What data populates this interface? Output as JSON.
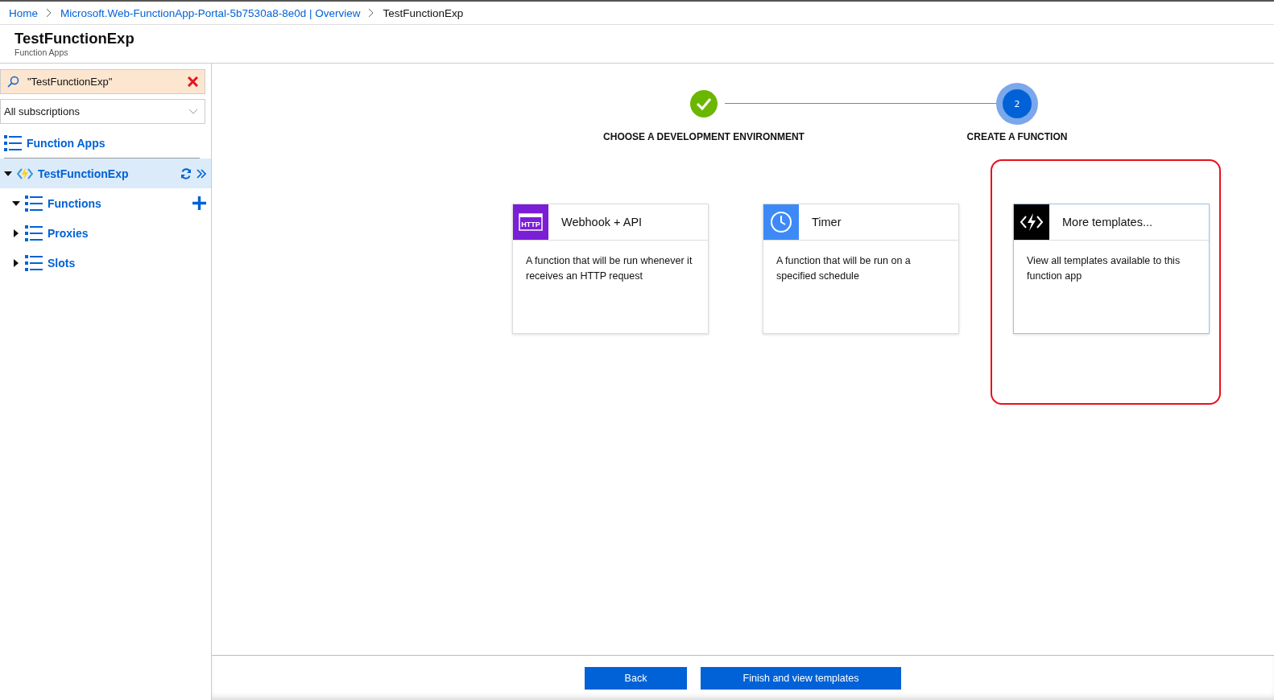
{
  "breadcrumb": [
    {
      "label": "Home",
      "link": true
    },
    {
      "label": "Microsoft.Web-FunctionApp-Portal-5b7530a8-8e0d | Overview",
      "link": true
    },
    {
      "label": "TestFunctionExp",
      "link": false
    }
  ],
  "header": {
    "title": "TestFunctionExp",
    "subtitle": "Function Apps"
  },
  "sidebar": {
    "search": {
      "value": "\"TestFunctionExp\""
    },
    "subscription": {
      "value": "All subscriptions"
    },
    "root": {
      "label": "Function Apps"
    },
    "tree": [
      {
        "label": "TestFunctionExp",
        "kind": "app",
        "expanded": true,
        "selected": true,
        "children": [
          {
            "label": "Functions",
            "kind": "list",
            "expanded": true,
            "selected": false
          },
          {
            "label": "Proxies",
            "kind": "list",
            "expanded": false,
            "selected": false
          },
          {
            "label": "Slots",
            "kind": "list",
            "expanded": false,
            "selected": false
          }
        ]
      }
    ]
  },
  "steps": [
    {
      "label": "CHOOSE A DEVELOPMENT ENVIRONMENT",
      "kind": "done"
    },
    {
      "label": "CREATE A FUNCTION",
      "kind": "current",
      "number": "2"
    }
  ],
  "templates": [
    {
      "kind": "http",
      "icon_text": "HTTP",
      "title": "Webhook + API",
      "description": "A function that will be run whenever it receives an HTTP request",
      "color": "#7a1fd6",
      "highlighted": false
    },
    {
      "kind": "timer",
      "title": "Timer",
      "description": "A function that will be run on a specified schedule",
      "color": "#3d8af7",
      "highlighted": false
    },
    {
      "kind": "more",
      "title": "More templates...",
      "description": "View all templates available to this function app",
      "color": "#000000",
      "highlighted": true
    }
  ],
  "buttons": [
    {
      "label": "Back"
    },
    {
      "label": "Finish and view templates"
    }
  ]
}
